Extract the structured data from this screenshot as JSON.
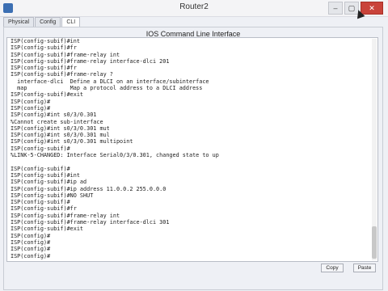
{
  "window": {
    "title": "Router2"
  },
  "tabs": [
    {
      "label": "Physical"
    },
    {
      "label": "Config"
    },
    {
      "label": "CLI"
    }
  ],
  "panel": {
    "title": "IOS Command Line Interface"
  },
  "terminal": {
    "lines": [
      "ISP(config-subif)#int",
      "ISP(config-subif)#fr",
      "ISP(config-subif)#frame-relay int",
      "ISP(config-subif)#frame-relay interface-dlci 201",
      "ISP(config-subif)#fr",
      "ISP(config-subif)#frame-relay ?",
      "  interface-dlci  Define a DLCI on an interface/subinterface",
      "  map             Map a protocol address to a DLCI address",
      "ISP(config-subif)#exit",
      "ISP(config)#",
      "ISP(config)#",
      "ISP(config)#int s0/3/0.301",
      "%Cannot create sub-interface",
      "ISP(config)#int s0/3/0.301 mut",
      "ISP(config)#int s0/3/0.301 mul",
      "ISP(config)#int s0/3/0.301 multipoint",
      "ISP(config-subif)#",
      "%LINK-5-CHANGED: Interface Serial0/3/0.301, changed state to up",
      "",
      "ISP(config-subif)#",
      "ISP(config-subif)#int",
      "ISP(config-subif)#ip ad",
      "ISP(config-subif)#ip address 11.0.0.2 255.0.0.0",
      "ISP(config-subif)#NO SHUT",
      "ISP(config-subif)#",
      "ISP(config-subif)#fr",
      "ISP(config-subif)#frame-relay int",
      "ISP(config-subif)#frame-relay interface-dlci 301",
      "ISP(config-subif)#exit",
      "ISP(config)#",
      "ISP(config)#",
      "ISP(config)#",
      "ISP(config)#"
    ]
  },
  "buttons": {
    "copy": "Copy",
    "paste": "Paste"
  }
}
